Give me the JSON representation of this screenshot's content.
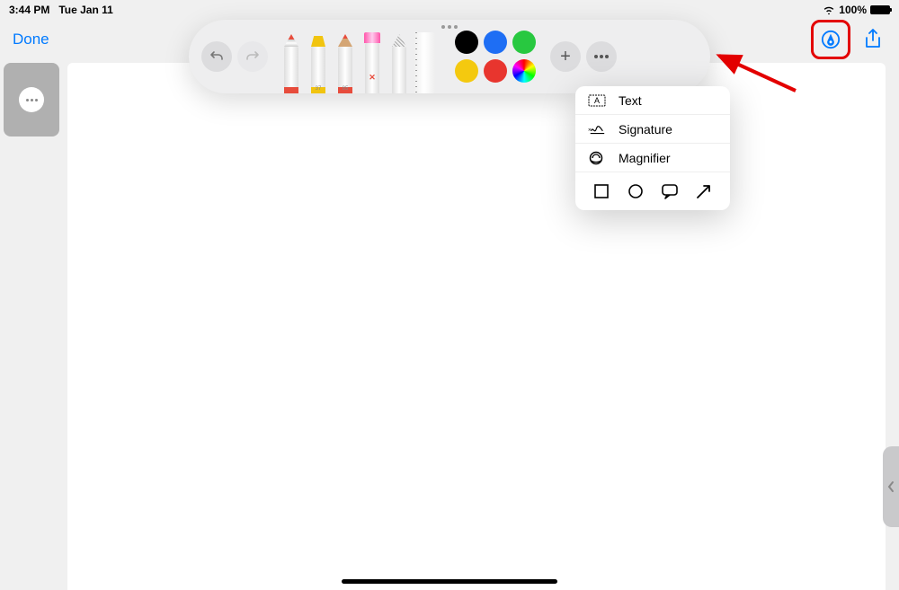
{
  "status": {
    "time": "3:44 PM",
    "date": "Tue Jan 11",
    "battery_pct": "100%"
  },
  "nav": {
    "done_label": "Done"
  },
  "toolbar": {
    "tools": [
      {
        "name": "pen"
      },
      {
        "name": "highlighter",
        "num": "37"
      },
      {
        "name": "pencil",
        "num": "85"
      },
      {
        "name": "eraser"
      },
      {
        "name": "lasso"
      },
      {
        "name": "ruler"
      }
    ],
    "colors_row1": [
      "#000000",
      "#1e6ef4",
      "#28c840"
    ],
    "colors_row2": [
      "#f4c90f",
      "#e8352e",
      "conic-gradient(red,yellow,lime,cyan,blue,magenta,red)"
    ]
  },
  "popover": {
    "items": [
      {
        "label": "Text",
        "icon": "text"
      },
      {
        "label": "Signature",
        "icon": "signature"
      },
      {
        "label": "Magnifier",
        "icon": "magnifier"
      }
    ],
    "shapes": [
      "square",
      "circle",
      "speech",
      "arrow"
    ]
  }
}
